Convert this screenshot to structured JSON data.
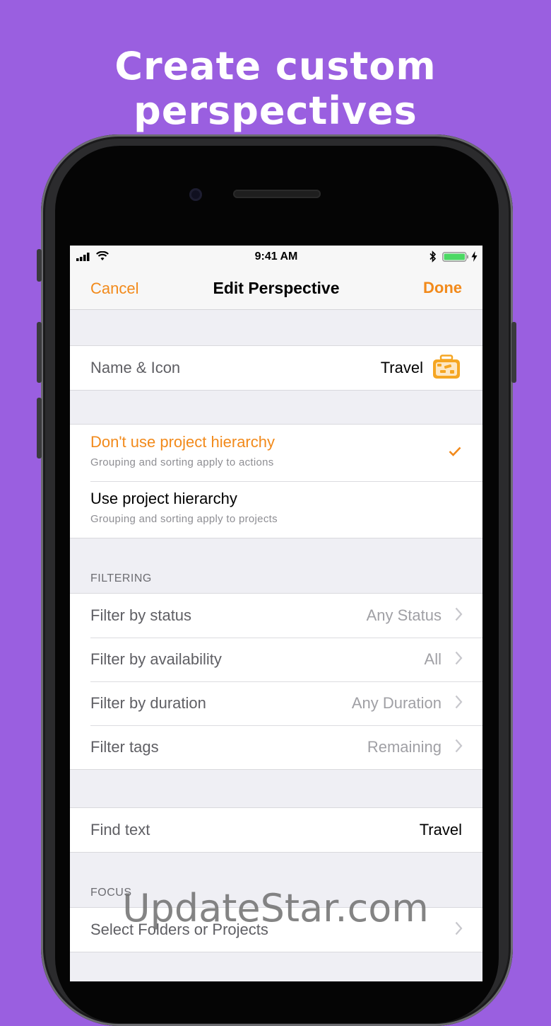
{
  "headline": "Create custom perspectives",
  "status_bar": {
    "time": "9:41 AM"
  },
  "nav": {
    "cancel": "Cancel",
    "title": "Edit Perspective",
    "done": "Done"
  },
  "name_icon": {
    "label": "Name & Icon",
    "value": "Travel",
    "icon": "briefcase-icon"
  },
  "hierarchy": {
    "options": [
      {
        "title": "Don't use project hierarchy",
        "subtitle": "Grouping and sorting apply to actions",
        "selected": true
      },
      {
        "title": "Use project hierarchy",
        "subtitle": "Grouping and sorting apply to projects",
        "selected": false
      }
    ]
  },
  "filtering": {
    "header": "FILTERING",
    "rows": [
      {
        "label": "Filter by status",
        "value": "Any Status"
      },
      {
        "label": "Filter by availability",
        "value": "All"
      },
      {
        "label": "Filter by duration",
        "value": "Any Duration"
      },
      {
        "label": "Filter tags",
        "value": "Remaining"
      }
    ]
  },
  "find_text": {
    "label": "Find text",
    "value": "Travel"
  },
  "focus": {
    "header": "FOCUS",
    "row_label": "Select Folders or Projects"
  },
  "watermark": "UpdateStar.com",
  "colors": {
    "accent": "#f28a1b",
    "background": "#9a5fe0",
    "battery": "#4cd964"
  }
}
